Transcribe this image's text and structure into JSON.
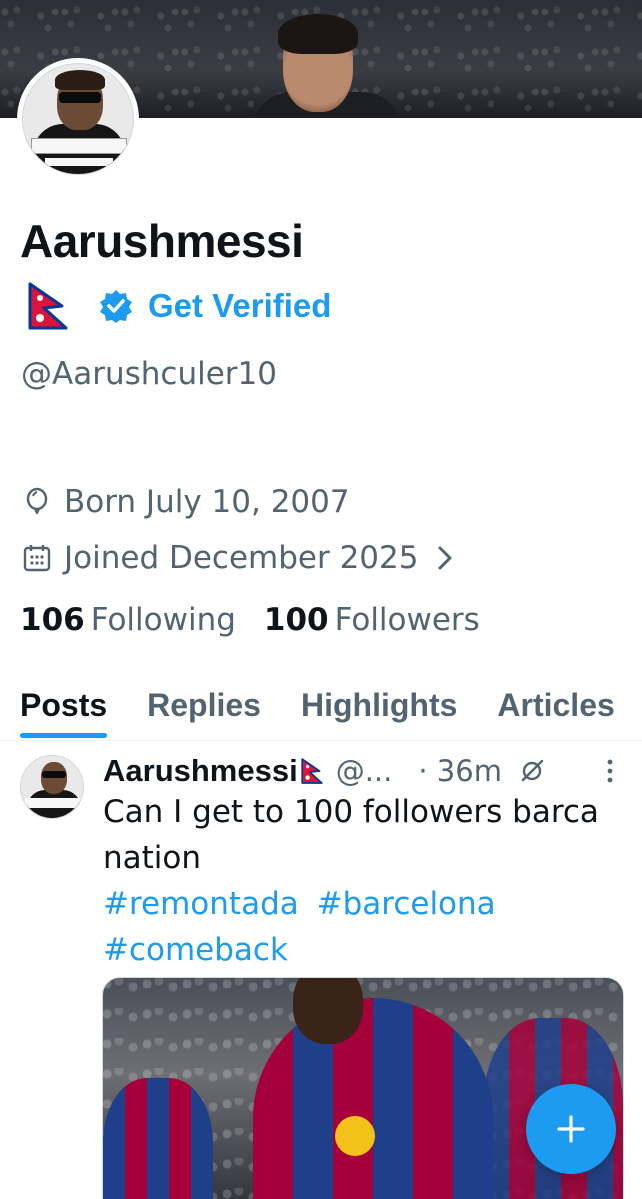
{
  "profile": {
    "name": "Aarushmessi",
    "get_verified_label": "Get Verified",
    "handle": "@Aarushculer10",
    "born": "Born July 10, 2007",
    "joined": "Joined December 2025",
    "following_count": "106",
    "following_label": "Following",
    "followers_count": "100",
    "followers_label": "Followers"
  },
  "tabs": [
    {
      "label": "Posts",
      "active": true
    },
    {
      "label": "Replies",
      "active": false
    },
    {
      "label": "Highlights",
      "active": false
    },
    {
      "label": "Articles",
      "active": false
    }
  ],
  "post": {
    "author_name": "Aarushmessi",
    "author_handle": "@...",
    "time": "· 36m",
    "text": "Can I get to 100 followers barca nation",
    "hashtags": [
      "#remontada",
      "#barcelona",
      "#comeback"
    ]
  },
  "colors": {
    "accent": "#1d9bf0",
    "text_primary": "#0f1419",
    "text_secondary": "#536471"
  },
  "icons": {
    "flag": "nepal-flag-icon",
    "verified": "verified-badge-icon",
    "born": "balloon-icon",
    "joined": "calendar-icon",
    "chevron": "chevron-right-icon",
    "grok": "grok-icon",
    "more": "more-vertical-icon",
    "compose": "plus-icon"
  }
}
